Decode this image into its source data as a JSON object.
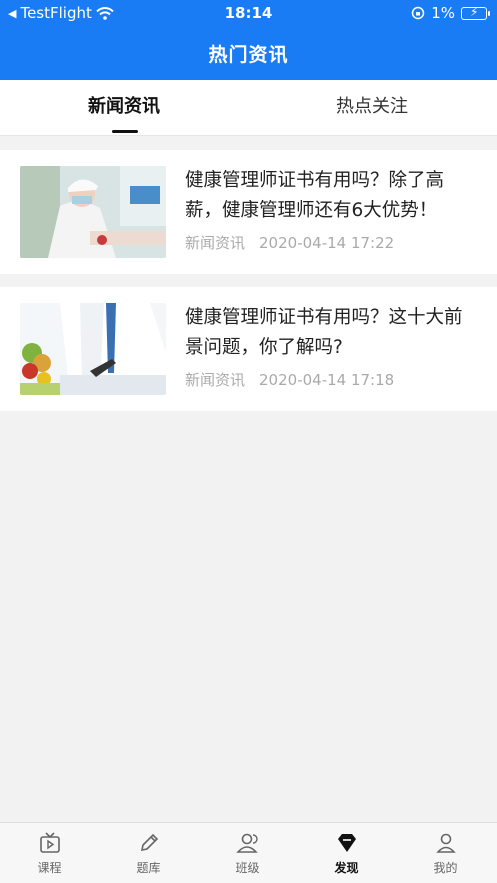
{
  "status_bar": {
    "back_app": "TestFlight",
    "time": "18:14",
    "battery": "1%"
  },
  "header": {
    "title": "热门资讯"
  },
  "tabs": [
    {
      "label": "新闻资讯",
      "active": true
    },
    {
      "label": "热点关注",
      "active": false
    }
  ],
  "news": [
    {
      "title": "健康管理师证书有用吗？除了高薪，健康管理师还有6大优势！",
      "category": "新闻资讯",
      "date": "2020-04-14 17:22"
    },
    {
      "title": "健康管理师证书有用吗？这十大前景问题，你了解吗?",
      "category": "新闻资讯",
      "date": "2020-04-14 17:18"
    }
  ],
  "bottom_nav": [
    {
      "label": "课程",
      "icon": "tv-icon",
      "active": false
    },
    {
      "label": "题库",
      "icon": "pencil-icon",
      "active": false
    },
    {
      "label": "班级",
      "icon": "group-icon",
      "active": false
    },
    {
      "label": "发现",
      "icon": "diamond-icon",
      "active": true
    },
    {
      "label": "我的",
      "icon": "person-icon",
      "active": false
    }
  ],
  "colors": {
    "primary": "#1a7cf5",
    "background": "#f2f2f2"
  }
}
